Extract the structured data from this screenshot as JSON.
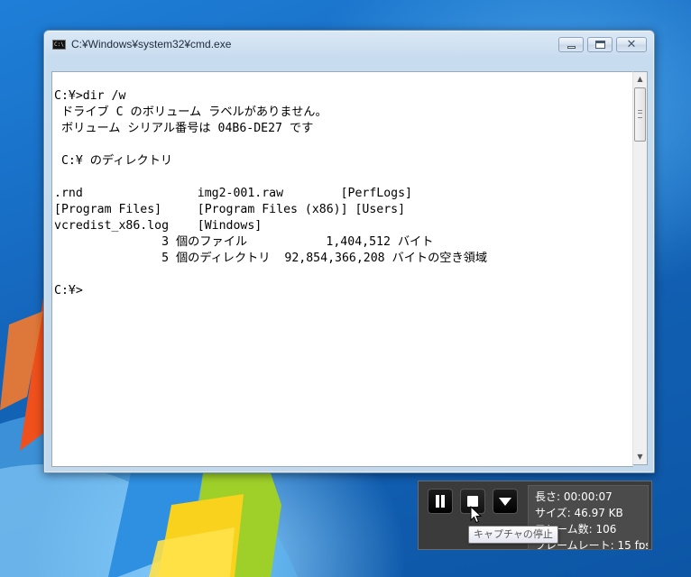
{
  "window": {
    "title": "C:¥Windows¥system32¥cmd.exe",
    "icon": "cmd-icon",
    "controls": {
      "minimize": "minimize-icon",
      "maximize": "maximize-icon",
      "close": "✕"
    }
  },
  "console": {
    "lines": [
      "",
      "C:¥>dir /w",
      " ドライブ C のボリューム ラベルがありません。",
      " ボリューム シリアル番号は 04B6-DE27 です",
      "",
      " C:¥ のディレクトリ",
      "",
      ".rnd                img2-001.raw        [PerfLogs]",
      "[Program Files]     [Program Files (x86)] [Users]",
      "vcredist_x86.log    [Windows]",
      "               3 個のファイル           1,404,512 バイト",
      "               5 個のディレクトリ  92,854,366,208 バイトの空き領域",
      "",
      "C:¥>"
    ]
  },
  "recorder": {
    "buttons": {
      "pause": "pause-icon",
      "stop": "stop-icon",
      "menu": "menu-down-icon"
    },
    "stats": {
      "length": "長さ: 00:00:07",
      "size": "サイズ: 46.97 KB",
      "frames": "フレーム数: 106",
      "fps": "フレームレート: 15 fps"
    },
    "tooltip": "キャプチャの停止"
  },
  "colors": {
    "console_bg": "#ffffff",
    "console_text": "#000000",
    "recorder_bg": "#3b3b3b",
    "desktop_blue": "#1363b8"
  }
}
